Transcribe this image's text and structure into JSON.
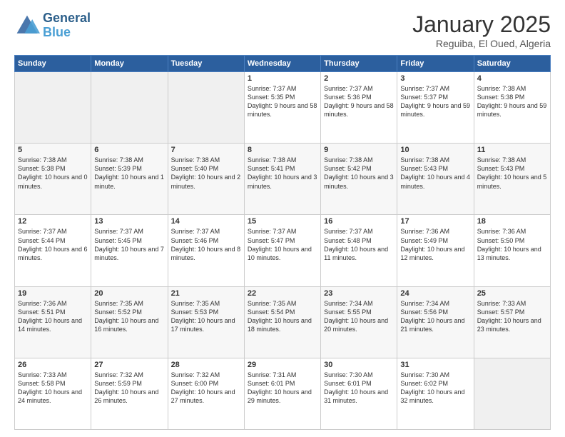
{
  "logo": {
    "line1": "General",
    "line2": "Blue"
  },
  "title": "January 2025",
  "subtitle": "Reguiba, El Oued, Algeria",
  "weekdays": [
    "Sunday",
    "Monday",
    "Tuesday",
    "Wednesday",
    "Thursday",
    "Friday",
    "Saturday"
  ],
  "weeks": [
    [
      {
        "day": "",
        "info": ""
      },
      {
        "day": "",
        "info": ""
      },
      {
        "day": "",
        "info": ""
      },
      {
        "day": "1",
        "info": "Sunrise: 7:37 AM\nSunset: 5:35 PM\nDaylight: 9 hours\nand 58 minutes."
      },
      {
        "day": "2",
        "info": "Sunrise: 7:37 AM\nSunset: 5:36 PM\nDaylight: 9 hours\nand 58 minutes."
      },
      {
        "day": "3",
        "info": "Sunrise: 7:37 AM\nSunset: 5:37 PM\nDaylight: 9 hours\nand 59 minutes."
      },
      {
        "day": "4",
        "info": "Sunrise: 7:38 AM\nSunset: 5:38 PM\nDaylight: 9 hours\nand 59 minutes."
      }
    ],
    [
      {
        "day": "5",
        "info": "Sunrise: 7:38 AM\nSunset: 5:38 PM\nDaylight: 10 hours\nand 0 minutes."
      },
      {
        "day": "6",
        "info": "Sunrise: 7:38 AM\nSunset: 5:39 PM\nDaylight: 10 hours\nand 1 minute."
      },
      {
        "day": "7",
        "info": "Sunrise: 7:38 AM\nSunset: 5:40 PM\nDaylight: 10 hours\nand 2 minutes."
      },
      {
        "day": "8",
        "info": "Sunrise: 7:38 AM\nSunset: 5:41 PM\nDaylight: 10 hours\nand 3 minutes."
      },
      {
        "day": "9",
        "info": "Sunrise: 7:38 AM\nSunset: 5:42 PM\nDaylight: 10 hours\nand 3 minutes."
      },
      {
        "day": "10",
        "info": "Sunrise: 7:38 AM\nSunset: 5:43 PM\nDaylight: 10 hours\nand 4 minutes."
      },
      {
        "day": "11",
        "info": "Sunrise: 7:38 AM\nSunset: 5:43 PM\nDaylight: 10 hours\nand 5 minutes."
      }
    ],
    [
      {
        "day": "12",
        "info": "Sunrise: 7:37 AM\nSunset: 5:44 PM\nDaylight: 10 hours\nand 6 minutes."
      },
      {
        "day": "13",
        "info": "Sunrise: 7:37 AM\nSunset: 5:45 PM\nDaylight: 10 hours\nand 7 minutes."
      },
      {
        "day": "14",
        "info": "Sunrise: 7:37 AM\nSunset: 5:46 PM\nDaylight: 10 hours\nand 8 minutes."
      },
      {
        "day": "15",
        "info": "Sunrise: 7:37 AM\nSunset: 5:47 PM\nDaylight: 10 hours\nand 10 minutes."
      },
      {
        "day": "16",
        "info": "Sunrise: 7:37 AM\nSunset: 5:48 PM\nDaylight: 10 hours\nand 11 minutes."
      },
      {
        "day": "17",
        "info": "Sunrise: 7:36 AM\nSunset: 5:49 PM\nDaylight: 10 hours\nand 12 minutes."
      },
      {
        "day": "18",
        "info": "Sunrise: 7:36 AM\nSunset: 5:50 PM\nDaylight: 10 hours\nand 13 minutes."
      }
    ],
    [
      {
        "day": "19",
        "info": "Sunrise: 7:36 AM\nSunset: 5:51 PM\nDaylight: 10 hours\nand 14 minutes."
      },
      {
        "day": "20",
        "info": "Sunrise: 7:35 AM\nSunset: 5:52 PM\nDaylight: 10 hours\nand 16 minutes."
      },
      {
        "day": "21",
        "info": "Sunrise: 7:35 AM\nSunset: 5:53 PM\nDaylight: 10 hours\nand 17 minutes."
      },
      {
        "day": "22",
        "info": "Sunrise: 7:35 AM\nSunset: 5:54 PM\nDaylight: 10 hours\nand 18 minutes."
      },
      {
        "day": "23",
        "info": "Sunrise: 7:34 AM\nSunset: 5:55 PM\nDaylight: 10 hours\nand 20 minutes."
      },
      {
        "day": "24",
        "info": "Sunrise: 7:34 AM\nSunset: 5:56 PM\nDaylight: 10 hours\nand 21 minutes."
      },
      {
        "day": "25",
        "info": "Sunrise: 7:33 AM\nSunset: 5:57 PM\nDaylight: 10 hours\nand 23 minutes."
      }
    ],
    [
      {
        "day": "26",
        "info": "Sunrise: 7:33 AM\nSunset: 5:58 PM\nDaylight: 10 hours\nand 24 minutes."
      },
      {
        "day": "27",
        "info": "Sunrise: 7:32 AM\nSunset: 5:59 PM\nDaylight: 10 hours\nand 26 minutes."
      },
      {
        "day": "28",
        "info": "Sunrise: 7:32 AM\nSunset: 6:00 PM\nDaylight: 10 hours\nand 27 minutes."
      },
      {
        "day": "29",
        "info": "Sunrise: 7:31 AM\nSunset: 6:01 PM\nDaylight: 10 hours\nand 29 minutes."
      },
      {
        "day": "30",
        "info": "Sunrise: 7:30 AM\nSunset: 6:01 PM\nDaylight: 10 hours\nand 31 minutes."
      },
      {
        "day": "31",
        "info": "Sunrise: 7:30 AM\nSunset: 6:02 PM\nDaylight: 10 hours\nand 32 minutes."
      },
      {
        "day": "",
        "info": ""
      }
    ]
  ]
}
